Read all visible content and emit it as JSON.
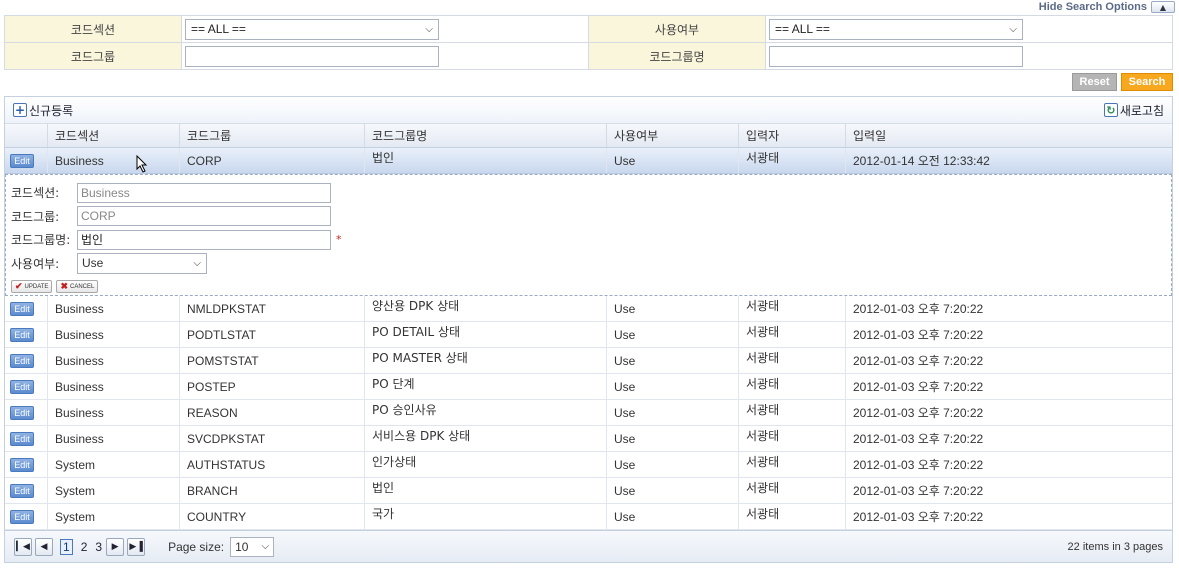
{
  "toggle": {
    "label": "Hide Search Options",
    "icon": "chevron-up-icon"
  },
  "search": {
    "row1": {
      "label1": "코드섹션",
      "value1": "== ALL ==",
      "label2": "사용여부",
      "value2": "== ALL =="
    },
    "row2": {
      "label1": "코드그룹",
      "value1": "",
      "label2": "코드그룹명",
      "value2": ""
    }
  },
  "buttons": {
    "reset": "Reset",
    "search": "Search"
  },
  "grid": {
    "add_label": "신규등록",
    "refresh_label": "새로고침",
    "columns": [
      "코드섹션",
      "코드그룹",
      "코드그룹명",
      "사용여부",
      "입력자",
      "입력일"
    ],
    "edit_label": "Edit",
    "selected_row": {
      "section": "Business",
      "group": "CORP",
      "name": "법인",
      "use": "Use",
      "user": "서광태",
      "date": "2012-01-14 오전 12:33:42"
    },
    "editor": {
      "section_label": "코드섹션:",
      "section_value": "Business",
      "group_label": "코드그룹:",
      "group_value": "CORP",
      "name_label": "코드그룹명:",
      "name_value": "법인",
      "required_mark": "*",
      "use_label": "사용여부:",
      "use_value": "Use",
      "update_label": "UPDATE",
      "cancel_label": "CANCEL"
    },
    "rows": [
      {
        "section": "Business",
        "group": "NMLDPKSTAT",
        "name": "양산용 DPK 상태",
        "use": "Use",
        "user": "서광태",
        "date": "2012-01-03 오후 7:20:22"
      },
      {
        "section": "Business",
        "group": "PODTLSTAT",
        "name": "PO DETAIL 상태",
        "use": "Use",
        "user": "서광태",
        "date": "2012-01-03 오후 7:20:22"
      },
      {
        "section": "Business",
        "group": "POMSTSTAT",
        "name": "PO MASTER 상태",
        "use": "Use",
        "user": "서광태",
        "date": "2012-01-03 오후 7:20:22"
      },
      {
        "section": "Business",
        "group": "POSTEP",
        "name": "PO 단계",
        "use": "Use",
        "user": "서광태",
        "date": "2012-01-03 오후 7:20:22"
      },
      {
        "section": "Business",
        "group": "REASON",
        "name": "PO 승인사유",
        "use": "Use",
        "user": "서광태",
        "date": "2012-01-03 오후 7:20:22"
      },
      {
        "section": "Business",
        "group": "SVCDPKSTAT",
        "name": "서비스용 DPK 상태",
        "use": "Use",
        "user": "서광태",
        "date": "2012-01-03 오후 7:20:22"
      },
      {
        "section": "System",
        "group": "AUTHSTATUS",
        "name": "인가상태",
        "use": "Use",
        "user": "서광태",
        "date": "2012-01-03 오후 7:20:22"
      },
      {
        "section": "System",
        "group": "BRANCH",
        "name": "법인",
        "use": "Use",
        "user": "서광태",
        "date": "2012-01-03 오후 7:20:22"
      },
      {
        "section": "System",
        "group": "COUNTRY",
        "name": "국가",
        "use": "Use",
        "user": "서광태",
        "date": "2012-01-03 오후 7:20:22"
      }
    ]
  },
  "pager": {
    "pages": [
      "1",
      "2",
      "3"
    ],
    "current_page": "1",
    "page_size_label": "Page size:",
    "page_size": "10",
    "total_items": "22",
    "items_in": "items in",
    "total_pages": "3",
    "pages_word": "pages"
  }
}
